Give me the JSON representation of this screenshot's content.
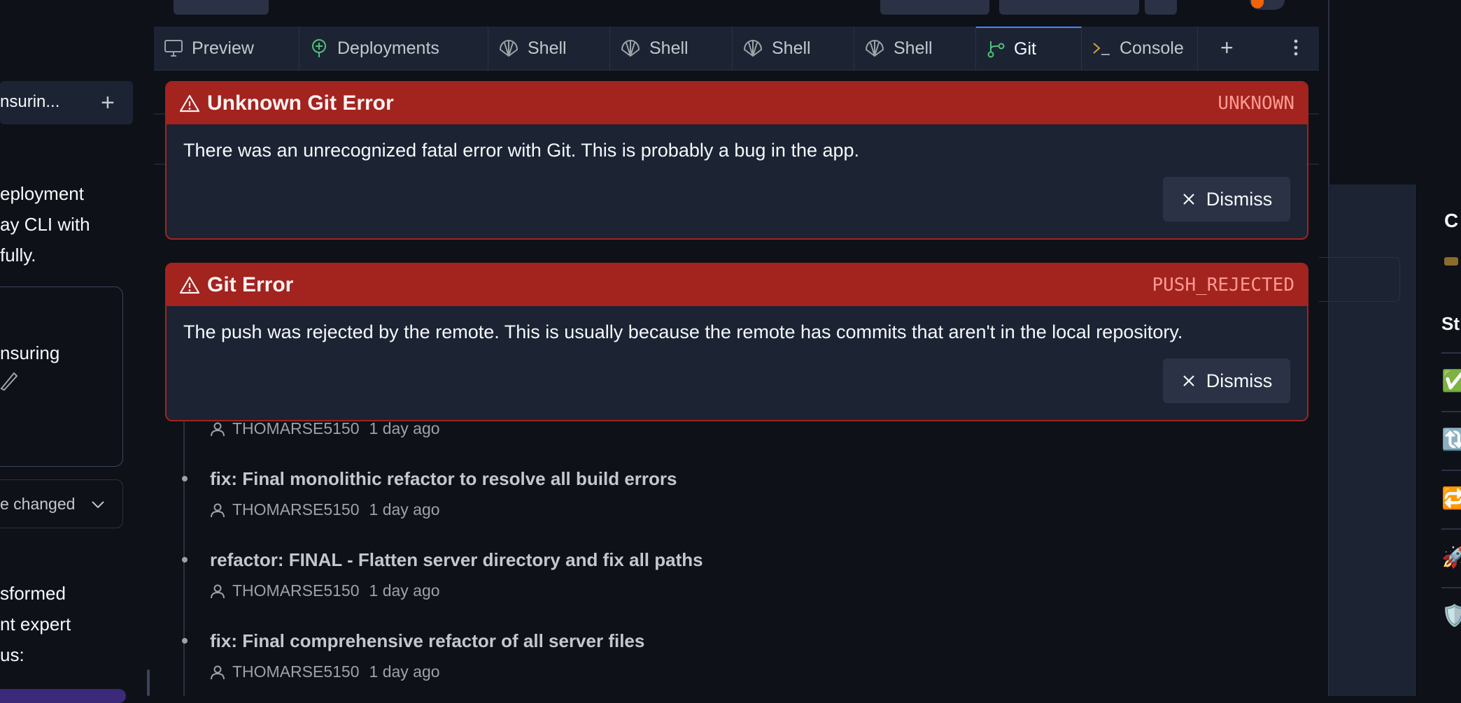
{
  "tabs": [
    {
      "label": "Preview",
      "icon": "monitor-icon"
    },
    {
      "label": "Deployments",
      "icon": "deployments-icon"
    },
    {
      "label": "Shell",
      "icon": "shell-icon"
    },
    {
      "label": "Shell",
      "icon": "shell-icon"
    },
    {
      "label": "Shell",
      "icon": "shell-icon"
    },
    {
      "label": "Shell",
      "icon": "shell-icon"
    },
    {
      "label": "Git",
      "icon": "git-icon",
      "active": true
    },
    {
      "label": "Console",
      "icon": "console-icon"
    }
  ],
  "chat": {
    "header_title": "nsurin...",
    "lines1": [
      "eployment",
      "ay CLI with",
      "fully."
    ],
    "card_text": "nsuring",
    "dropdown_label": "e changed",
    "lines2": [
      "sformed",
      "nt expert",
      "us:"
    ]
  },
  "errors": [
    {
      "title": "Unknown Git Error",
      "code": "UNKNOWN",
      "message": "There was an unrecognized fatal error with Git. This is probably a bug in the app.",
      "dismiss": "Dismiss"
    },
    {
      "title": "Git Error",
      "code": "PUSH_REJECTED",
      "message": "The push was rejected by the remote. This is usually because the remote has commits that aren't in the local repository.",
      "dismiss": "Dismiss"
    }
  ],
  "commits": [
    {
      "title": "",
      "author": "THOMARSE5150",
      "time": "1 day ago"
    },
    {
      "title": "fix: Final monolithic refactor to resolve all build errors",
      "author": "THOMARSE5150",
      "time": "1 day ago"
    },
    {
      "title": "refactor: FINAL - Flatten server directory and fix all paths",
      "author": "THOMARSE5150",
      "time": "1 day ago"
    },
    {
      "title": "fix: Final comprehensive refactor of all server files",
      "author": "THOMARSE5150",
      "time": "1 day ago"
    }
  ],
  "right": {
    "heading_c": "C",
    "heading_st": "St",
    "emojis": [
      "✅",
      "🔃",
      "🔁",
      "🚀",
      "🛡️"
    ]
  },
  "colors": {
    "error_red": "#a3231f",
    "error_code": "#ff9a93",
    "bg": "#0e1117",
    "surface": "#1c2333",
    "active_tab": "#3c8dff"
  }
}
